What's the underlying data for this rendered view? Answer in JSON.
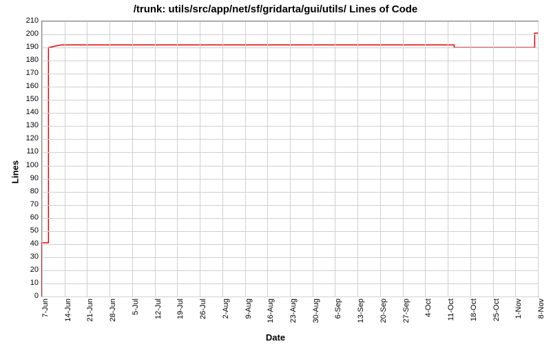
{
  "chart_data": {
    "type": "line",
    "title": "/trunk: utils/src/app/net/sf/gridarta/gui/utils/ Lines of Code",
    "xlabel": "Date",
    "ylabel": "Lines",
    "ylim": [
      0,
      210
    ],
    "y_ticks": [
      0,
      10,
      20,
      30,
      40,
      50,
      60,
      70,
      80,
      90,
      100,
      110,
      120,
      130,
      140,
      150,
      160,
      170,
      180,
      190,
      200,
      210
    ],
    "x_ticks": [
      "7-Jun",
      "14-Jun",
      "21-Jun",
      "28-Jun",
      "5-Jul",
      "12-Jul",
      "19-Jul",
      "26-Jul",
      "2-Aug",
      "9-Aug",
      "16-Aug",
      "23-Aug",
      "30-Aug",
      "6-Sep",
      "13-Sep",
      "20-Sep",
      "27-Sep",
      "4-Oct",
      "11-Oct",
      "18-Oct",
      "25-Oct",
      "1-Nov",
      "8-Nov"
    ],
    "x_range_days": [
      0,
      154
    ],
    "series": [
      {
        "name": "Lines of Code",
        "color": "#e00000",
        "points": [
          {
            "x_day": 0,
            "y": 0
          },
          {
            "x_day": 0,
            "y": 41
          },
          {
            "x_day": 2,
            "y": 41
          },
          {
            "x_day": 2,
            "y": 190
          },
          {
            "x_day": 6,
            "y": 192
          },
          {
            "x_day": 128,
            "y": 192
          },
          {
            "x_day": 128,
            "y": 190
          },
          {
            "x_day": 153,
            "y": 190
          },
          {
            "x_day": 153,
            "y": 201
          },
          {
            "x_day": 154,
            "y": 201
          }
        ]
      }
    ]
  }
}
